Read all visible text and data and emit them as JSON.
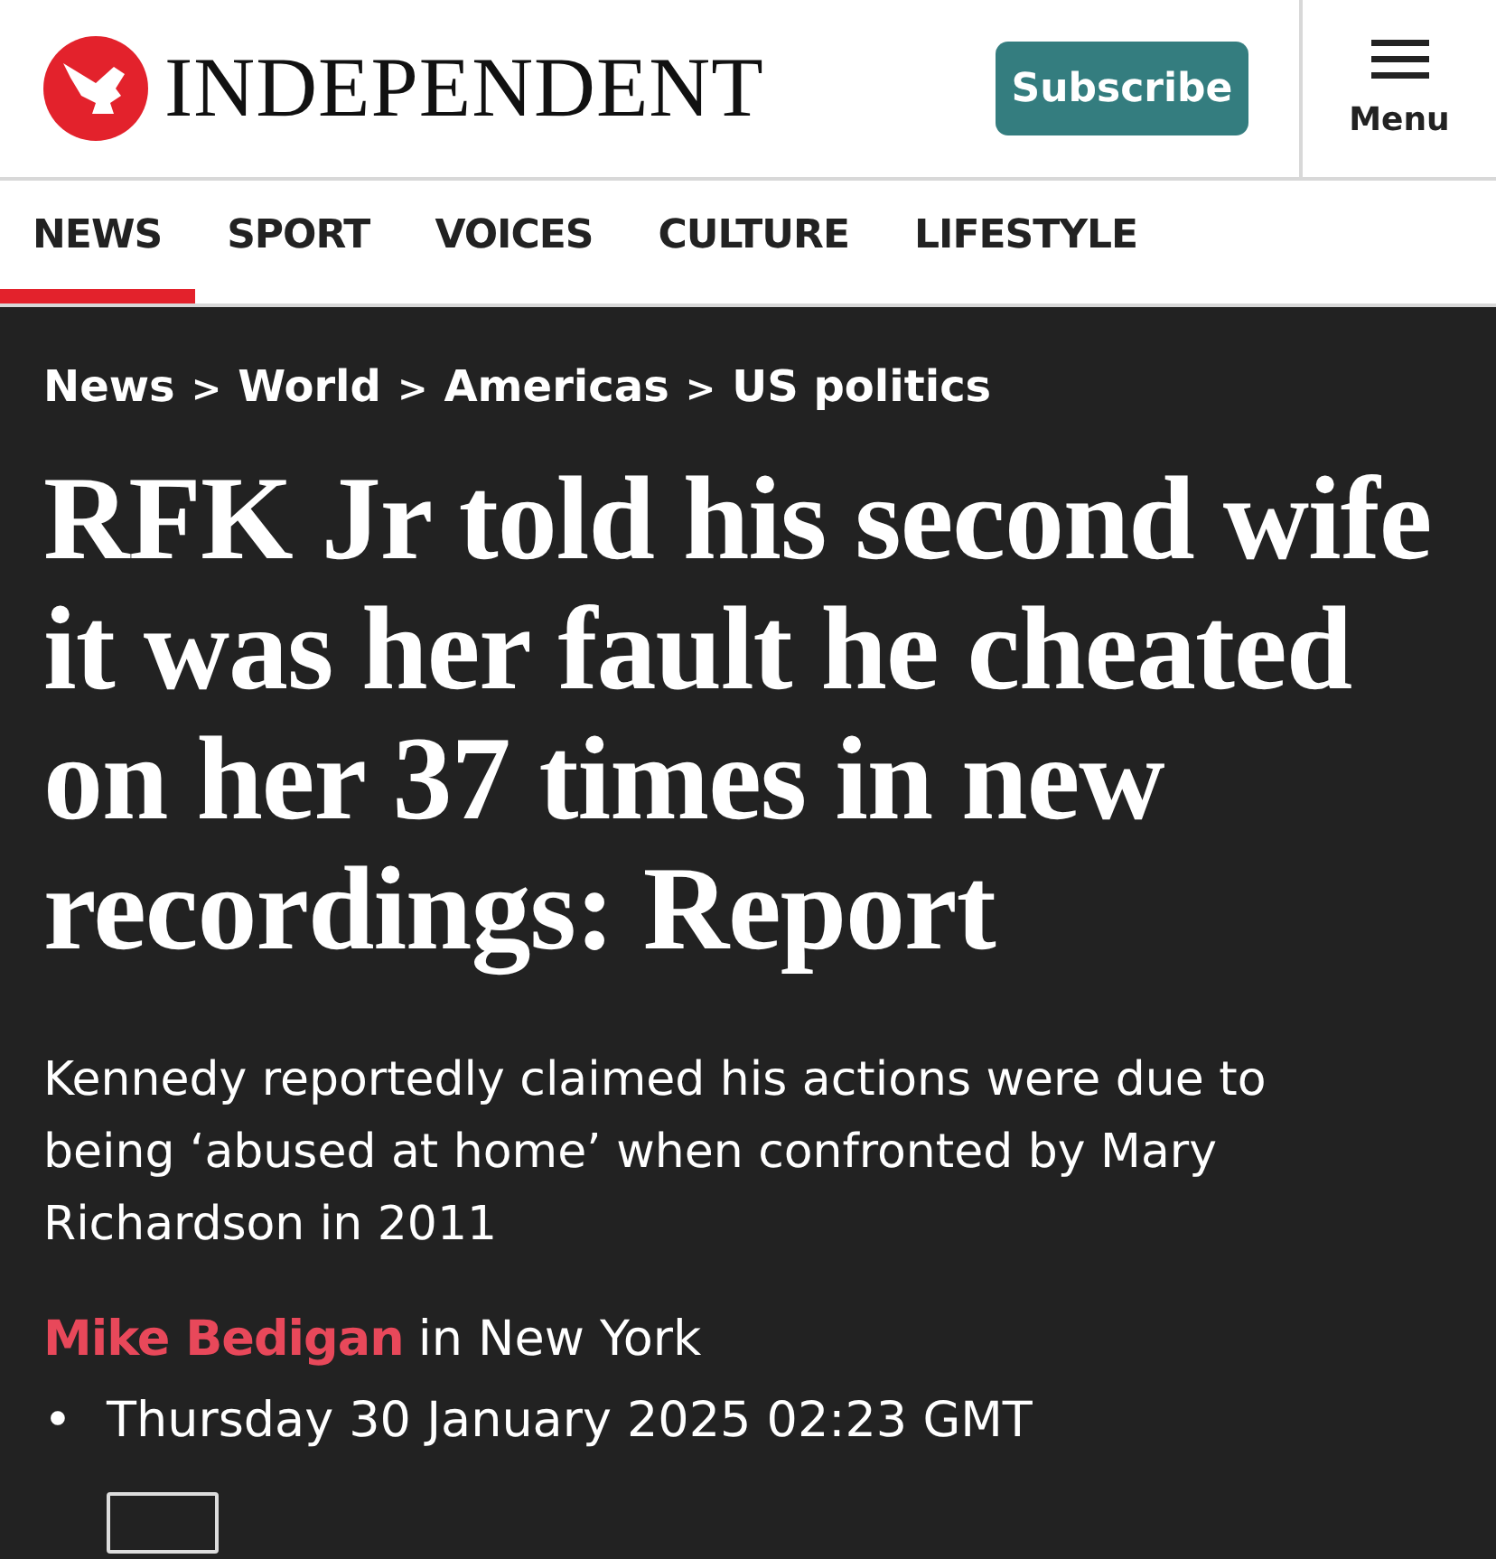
{
  "header": {
    "logo": "INDEPENDENT",
    "subscribe": "Subscribe",
    "menu": "Menu"
  },
  "tabs": [
    {
      "label": "NEWS",
      "selected": true
    },
    {
      "label": "SPORT",
      "selected": false
    },
    {
      "label": "VOICES",
      "selected": false
    },
    {
      "label": "CULTURE",
      "selected": false
    },
    {
      "label": "LIFESTYLE",
      "selected": false
    }
  ],
  "breadcrumb": [
    {
      "kind": "link",
      "text": "News"
    },
    {
      "kind": "separator",
      "text": ">"
    },
    {
      "kind": "link",
      "text": "World"
    },
    {
      "kind": "separator",
      "text": ">"
    },
    {
      "kind": "link",
      "text": "Americas"
    },
    {
      "kind": "separator",
      "text": ">"
    },
    {
      "kind": "link",
      "text": "US politics"
    }
  ],
  "headline": "RFK Jr told his second wife it was her fault he cheated on her 37 times in new recordings: Report",
  "standfirst": "Kennedy reportedly claimed his actions were due to being ‘abused at home’ when confronted by Mary Richardson in 2011",
  "byline": {
    "author": "Mike Bedigan",
    "location": "in New York"
  },
  "date": {
    "bullet": "•",
    "text": "Thursday 30 January 2025 02:23 GMT"
  }
}
